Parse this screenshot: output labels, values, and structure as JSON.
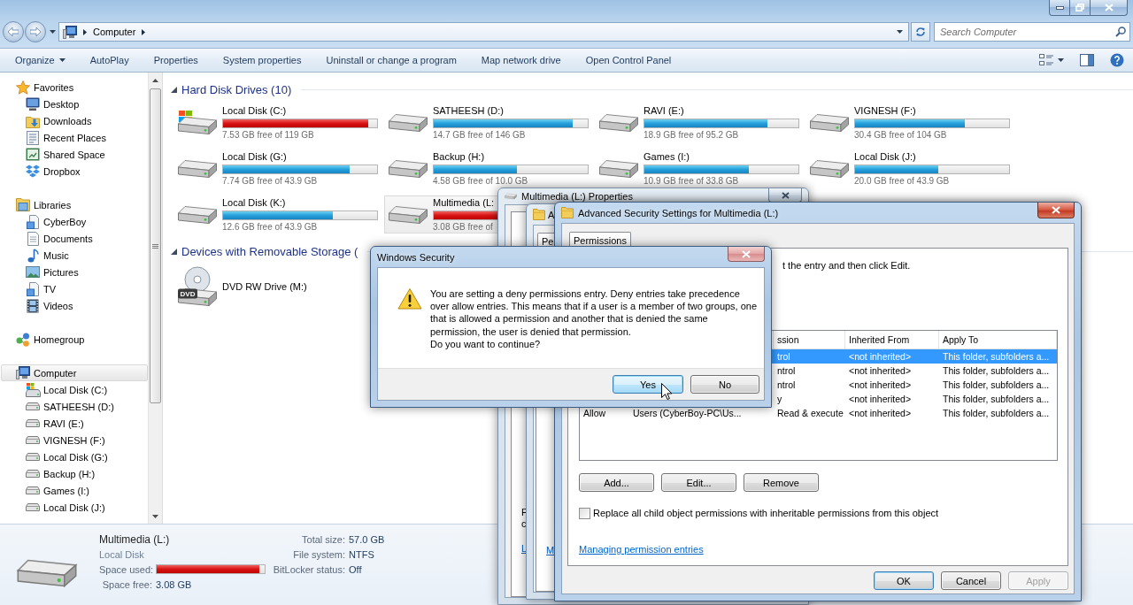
{
  "address": {
    "breadcrumb": [
      "Computer"
    ]
  },
  "search": {
    "placeholder": "Search Computer"
  },
  "toolbar": {
    "items": [
      {
        "label": "Organize",
        "kind": "menu"
      },
      {
        "label": "AutoPlay",
        "kind": "button"
      },
      {
        "label": "Properties",
        "kind": "button"
      },
      {
        "label": "System properties",
        "kind": "button"
      },
      {
        "label": "Uninstall or change a program",
        "kind": "button"
      },
      {
        "label": "Map network drive",
        "kind": "button"
      },
      {
        "label": "Open Control Panel",
        "kind": "button"
      }
    ]
  },
  "sidebar": {
    "sections": [
      {
        "label": "Favorites",
        "selected": false,
        "items": [
          {
            "label": "Desktop",
            "selected": false
          },
          {
            "label": "Downloads",
            "selected": false
          },
          {
            "label": "Recent Places",
            "selected": false
          },
          {
            "label": "Shared Space",
            "selected": false
          },
          {
            "label": "Dropbox",
            "selected": false
          }
        ]
      },
      {
        "label": "Libraries",
        "selected": false,
        "items": [
          {
            "label": "CyberBoy",
            "selected": false
          },
          {
            "label": "Documents",
            "selected": false
          },
          {
            "label": "Music",
            "selected": false
          },
          {
            "label": "Pictures",
            "selected": false
          },
          {
            "label": "TV",
            "selected": false
          },
          {
            "label": "Videos",
            "selected": false
          }
        ]
      },
      {
        "label": "Homegroup",
        "selected": false
      },
      {
        "label": "Computer",
        "selected": true,
        "items": [
          {
            "label": "Local Disk (C:)",
            "kind": "system",
            "selected": false
          },
          {
            "label": "SATHEESH (D:)",
            "kind": "disk",
            "selected": false
          },
          {
            "label": "RAVI (E:)",
            "kind": "disk",
            "selected": false
          },
          {
            "label": "VIGNESH (F:)",
            "kind": "disk",
            "selected": false
          },
          {
            "label": "Local Disk (G:)",
            "kind": "disk",
            "selected": false
          },
          {
            "label": "Backup (H:)",
            "kind": "disk",
            "selected": false
          },
          {
            "label": "Games (I:)",
            "kind": "disk",
            "selected": false
          },
          {
            "label": "Local Disk (J:)",
            "kind": "disk",
            "selected": false
          }
        ]
      }
    ]
  },
  "content": {
    "groups": [
      {
        "title": "Hard Disk Drives (10)",
        "expanded": true,
        "items": [
          {
            "name": "Local Disk (C:)",
            "kind": "system",
            "level": 0.94,
            "free": "7.53 GB free of 119 GB",
            "selected": false
          },
          {
            "name": "SATHEESH (D:)",
            "kind": "disk",
            "level": 0.9,
            "free": "14.7 GB free of 146 GB",
            "selected": false
          },
          {
            "name": "RAVI (E:)",
            "kind": "disk",
            "level": 0.8,
            "free": "18.9 GB free of 95.2 GB",
            "selected": false
          },
          {
            "name": "VIGNESH (F:)",
            "kind": "disk",
            "level": 0.71,
            "free": "30.4 GB free of 104 GB",
            "selected": false
          },
          {
            "name": "Local Disk (G:)",
            "kind": "disk",
            "level": 0.82,
            "free": "7.74 GB free of 43.9 GB",
            "selected": false
          },
          {
            "name": "Backup (H:)",
            "kind": "disk",
            "level": 0.54,
            "free": "4.58 GB free of 10.0 GB",
            "selected": false
          },
          {
            "name": "Games (I:)",
            "kind": "disk",
            "level": 0.68,
            "free": "10.9 GB free of 33.8 GB",
            "selected": false
          },
          {
            "name": "Local Disk (J:)",
            "kind": "disk",
            "level": 0.54,
            "free": "20.0 GB free of 43.9 GB",
            "selected": false
          },
          {
            "name": "Local Disk (K:)",
            "kind": "disk",
            "level": 0.71,
            "free": "12.6 GB free of 43.9 GB",
            "selected": false
          },
          {
            "name": "Multimedia (L:",
            "kind": "disk",
            "level": 0.95,
            "free": "3.08 GB free of",
            "selected": true
          }
        ]
      },
      {
        "title": "Devices with Removable Storage (",
        "expanded": true,
        "items": [
          {
            "name": "DVD RW Drive (M:)",
            "kind": "dvd",
            "badge": "DVD",
            "selected": false
          }
        ]
      }
    ]
  },
  "details": {
    "name": "Multimedia (L:)",
    "type": "Local Disk",
    "space_used": {
      "label": "Space used:",
      "level": 0.95
    },
    "space_free": {
      "label": "Space free:",
      "value": "3.08 GB"
    },
    "properties": [
      {
        "label": "Total size:",
        "value": "57.0 GB"
      },
      {
        "label": "File system:",
        "value": "NTFS"
      },
      {
        "label": "BitLocker status:",
        "value": "Off"
      }
    ]
  },
  "properties_window": {
    "title": "Multimedia (L:) Properties",
    "text_fragments": [
      "F",
      "c"
    ],
    "link": "L"
  },
  "security_window": {
    "title": "A",
    "tab": "Pe",
    "link": "M"
  },
  "advanced_window": {
    "title": "Advanced Security Settings for Multimedia (L:)",
    "tabs": [
      {
        "label": "Permissions",
        "selected": true
      }
    ],
    "instruction": "t the entry and then click Edit.",
    "table": {
      "columns": [
        "ssion",
        "Inherited From",
        "Apply To"
      ],
      "rows": [
        {
          "selected": true,
          "permission": "trol",
          "inherited_from": "<not inherited>",
          "apply_to": "This folder, subfolders a..."
        },
        {
          "selected": false,
          "permission": "ntrol",
          "inherited_from": "<not inherited>",
          "apply_to": "This folder, subfolders a..."
        },
        {
          "selected": false,
          "permission": "ntrol",
          "inherited_from": "<not inherited>",
          "apply_to": "This folder, subfolders a..."
        },
        {
          "selected": false,
          "permission": "y",
          "inherited_from": "<not inherited>",
          "apply_to": "This folder, subfolders a..."
        },
        {
          "selected": false,
          "type": "Allow",
          "name": "Users (CyberBoy-PC\\Us...",
          "permission": "Read & execute",
          "inherited_from": "<not inherited>",
          "apply_to": "This folder, subfolders a..."
        }
      ]
    },
    "actions": [
      "Add...",
      "Edit...",
      "Remove"
    ],
    "checkbox": {
      "label": "Replace all child object permissions with inheritable permissions from this object",
      "checked": false
    },
    "link": "Managing permission entries",
    "buttons": [
      {
        "label": "OK",
        "default": true,
        "disabled": false
      },
      {
        "label": "Cancel",
        "default": false,
        "disabled": false
      },
      {
        "label": "Apply",
        "default": false,
        "disabled": true
      }
    ]
  },
  "security_warning": {
    "title": "Windows Security",
    "message": "You are setting a deny permissions entry. Deny entries take precedence over allow entries. This means that if a user is a member of two groups, one that is allowed a permission and another that is denied the same permission, the user is denied that permission.",
    "question": "Do you want to continue?",
    "buttons": [
      {
        "label": "Yes",
        "default": true,
        "hovered": true
      },
      {
        "label": "No",
        "default": false,
        "hovered": false
      }
    ]
  }
}
